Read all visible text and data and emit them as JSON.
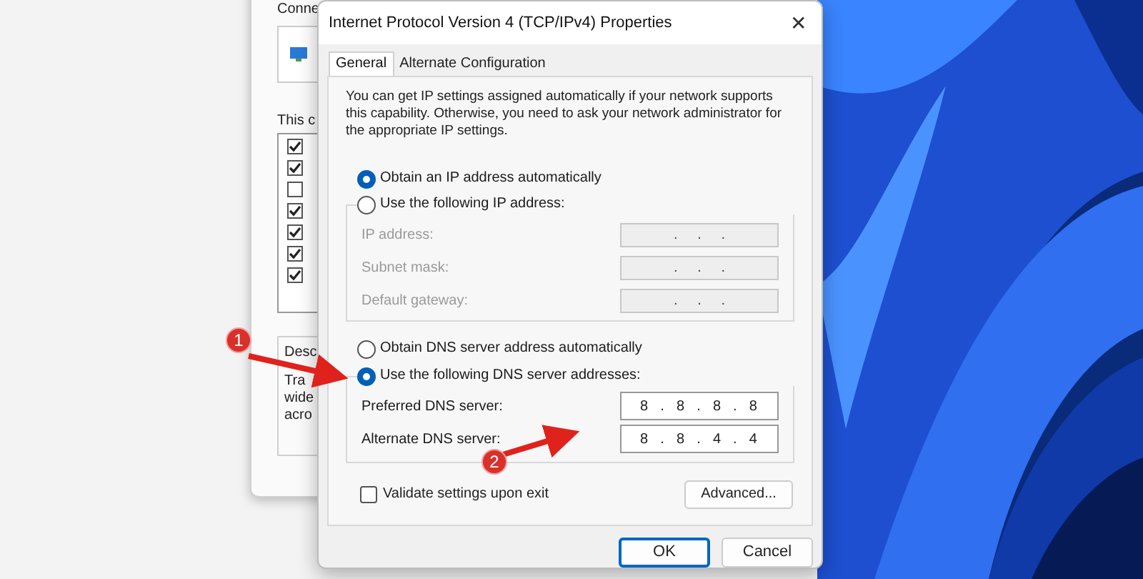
{
  "background_window": {
    "header": "Conne",
    "list_label": "This c",
    "components": [
      {
        "checked": true
      },
      {
        "checked": true
      },
      {
        "checked": false
      },
      {
        "checked": true
      },
      {
        "checked": true
      },
      {
        "checked": true
      },
      {
        "checked": true
      }
    ],
    "description_label": "Desc",
    "description_lines": [
      "Tra",
      "wide",
      "acro"
    ]
  },
  "dialog": {
    "title": "Internet Protocol Version 4 (TCP/IPv4) Properties",
    "close": "✕",
    "tabs": [
      {
        "label": "General",
        "selected": true
      },
      {
        "label": "Alternate Configuration",
        "selected": false
      }
    ],
    "intro": "You can get IP settings assigned automatically if your network supports this capability. Otherwise, you need to ask your network administrator for the appropriate IP settings.",
    "ip_auto": {
      "label": "Obtain an IP address automatically",
      "selected": true
    },
    "ip_manual": {
      "label": "Use the following IP address:",
      "selected": false,
      "fields": [
        {
          "label": "IP address:",
          "value": ".     .     .",
          "disabled": true
        },
        {
          "label": "Subnet mask:",
          "value": ".     .     .",
          "disabled": true
        },
        {
          "label": "Default gateway:",
          "value": ".     .     .",
          "disabled": true
        }
      ]
    },
    "dns_auto": {
      "label": "Obtain DNS server address automatically",
      "selected": false
    },
    "dns_manual": {
      "label": "Use the following DNS server addresses:",
      "selected": true,
      "fields": [
        {
          "label": "Preferred DNS server:",
          "value": "8  .  8  .  8  .  8",
          "disabled": false
        },
        {
          "label": "Alternate DNS server:",
          "value": "8  .  8  .  4  .  4",
          "disabled": false
        }
      ]
    },
    "validate": {
      "label": "Validate settings upon exit",
      "checked": false
    },
    "advanced_button": "Advanced...",
    "ok_button": "OK",
    "cancel_button": "Cancel"
  },
  "annotations": [
    {
      "label": "1"
    },
    {
      "label": "2"
    }
  ]
}
